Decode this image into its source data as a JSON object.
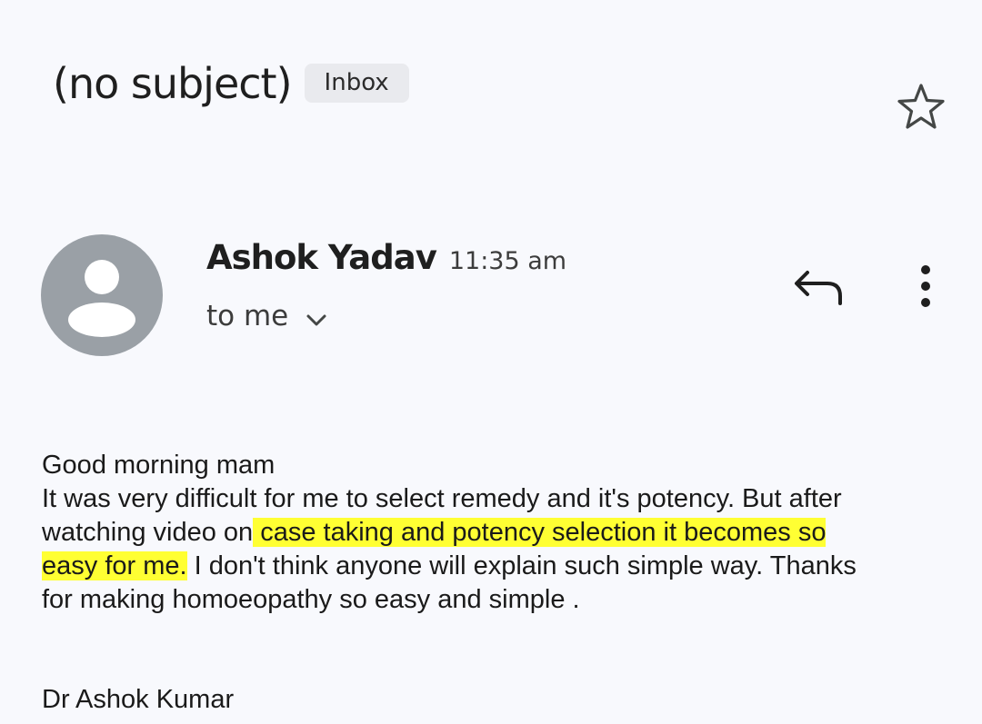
{
  "header": {
    "subject": "(no subject)",
    "label": "Inbox",
    "star_icon": "star-outline-icon"
  },
  "message": {
    "sender_name": "Ashok Yadav",
    "time": "11:35 am",
    "recipient": "to me",
    "avatar_icon": "person-avatar-icon",
    "reply_icon": "reply-icon",
    "more_icon": "more-vert-icon",
    "expand_icon": "chevron-down-icon"
  },
  "body": {
    "greeting": "Good morning mam",
    "line1": "It was very difficult for me to select remedy and it's potency. But after",
    "line2_pre": "watching video on",
    "line2_hl": " case taking and potency selection it becomes so ",
    "line3_hl": "easy for me.",
    "line3_post": " I don't think anyone will explain such simple way. Thanks",
    "line4": "for making homoeopathy so easy and simple .",
    "signature": "Dr Ashok Kumar"
  },
  "colors": {
    "background": "#f8f9fd",
    "highlight": "#ffff33",
    "avatar": "#9aa0a6",
    "chip": "#e9eaee"
  }
}
